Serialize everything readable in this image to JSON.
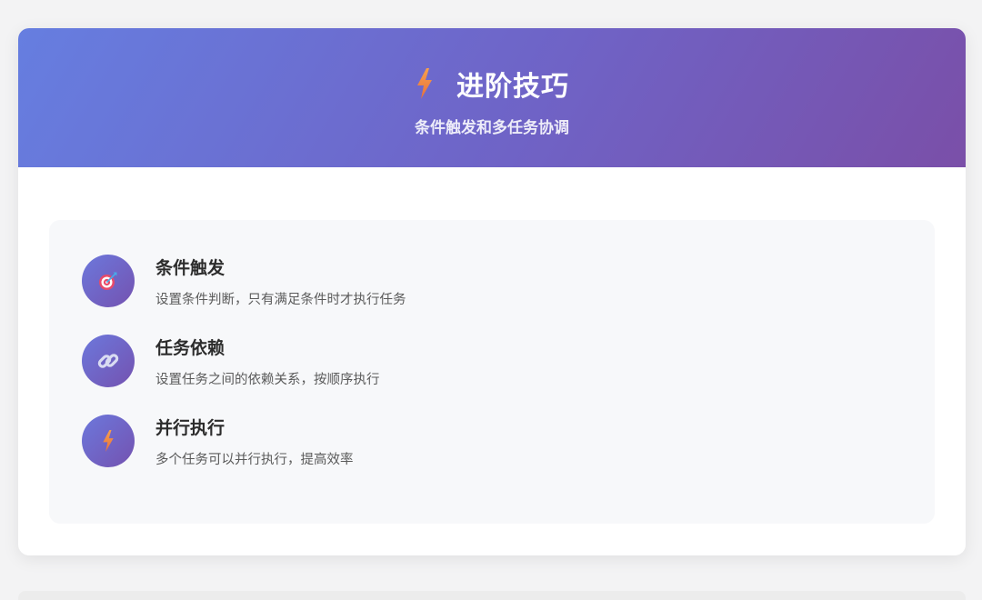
{
  "header": {
    "icon": "lightning-icon",
    "title": "进阶技巧",
    "subtitle": "条件触发和多任务协调"
  },
  "features": [
    {
      "icon": "target-icon",
      "title": "条件触发",
      "description": "设置条件判断，只有满足条件时才执行任务"
    },
    {
      "icon": "link-icon",
      "title": "任务依赖",
      "description": "设置任务之间的依赖关系，按顺序执行"
    },
    {
      "icon": "lightning-icon",
      "title": "并行执行",
      "description": "多个任务可以并行执行，提高效率"
    }
  ],
  "colors": {
    "header_gradient_start": "#667ee0",
    "header_gradient_end": "#7a4fa8",
    "icon_circle_start": "#6c78dc",
    "icon_circle_end": "#7452b0",
    "lightning": "#f0883e"
  }
}
